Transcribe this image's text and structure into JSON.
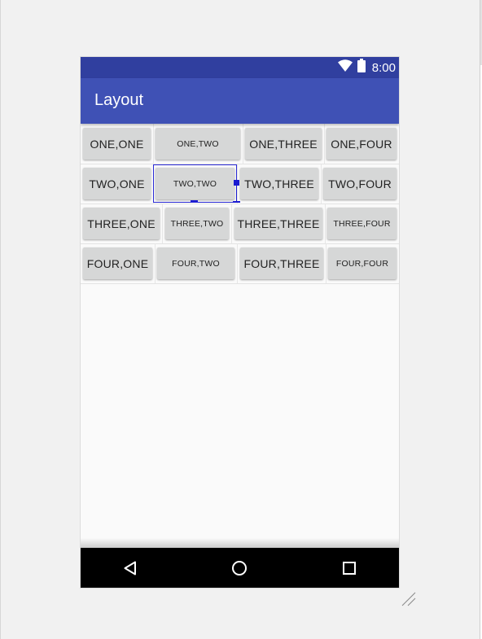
{
  "status_bar": {
    "time": "8:00",
    "icons": [
      "wifi-icon",
      "battery-icon"
    ],
    "color": "#303f9f"
  },
  "app_bar": {
    "title": "Layout",
    "color": "#3f51b5"
  },
  "table": {
    "rows": [
      {
        "cells": [
          "ONE,ONE",
          "ONE,TWO",
          "ONE,THREE",
          "ONE,FOUR"
        ]
      },
      {
        "cells": [
          "TWO,ONE",
          "TWO,TWO",
          "TWO,THREE",
          "TWO,FOUR"
        ]
      },
      {
        "cells": [
          "THREE,ONE",
          "THREE,TWO",
          "THREE,THREE",
          "THREE,FOUR"
        ]
      },
      {
        "cells": [
          "FOUR,ONE",
          "FOUR,TWO",
          "FOUR,THREE",
          "FOUR,FOUR"
        ]
      }
    ],
    "selected_cell": "TWO,TWO"
  },
  "nav_bar": {
    "icons": [
      "back-icon",
      "home-icon",
      "recents-icon"
    ]
  },
  "colors": {
    "button_bg": "#d6d7d7",
    "selection": "#2b2bd6",
    "background": "#fafafa"
  }
}
